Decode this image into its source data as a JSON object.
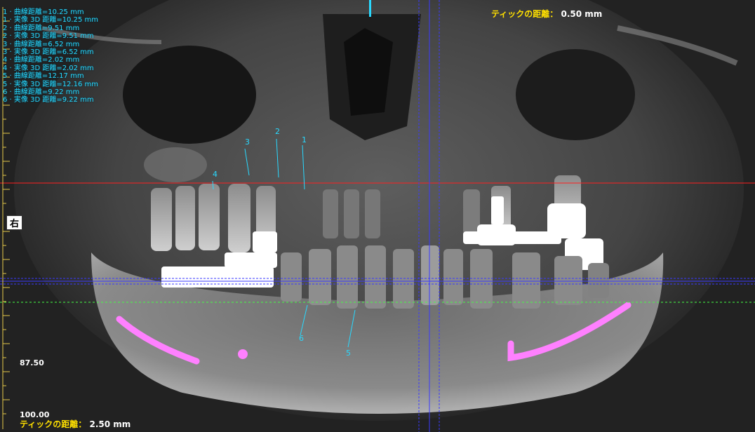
{
  "measurements": [
    "1 · 曲線距離=10.25 mm",
    "1 · 実像 3D 距離=10.25 mm",
    "2 · 曲線距離=9.51 mm",
    "2 · 実像 3D 距離=9.51 mm",
    "3 · 曲線距離=6.52 mm",
    "3 · 実像 3D 距離=6.52 mm",
    "4 · 曲線距離=2.02 mm",
    "4 · 実像 3D 距離=2.02 mm",
    "5 · 曲線距離=12.17 mm",
    "5 · 実像 3D 距離=12.16 mm",
    "6 · 曲線距離=9.22 mm",
    "6 · 実像 3D 距離=9.22 mm"
  ],
  "tick_top": {
    "label": "ティックの距離：",
    "value": "0.50 mm"
  },
  "tick_bottom": {
    "label": "ティックの距離：",
    "value": "2.50 mm"
  },
  "ruler": {
    "label_a": "87.50",
    "label_b": "100.00"
  },
  "side_label": "右",
  "marker_numbers": [
    "1",
    "2",
    "3",
    "4",
    "5",
    "6"
  ],
  "colors": {
    "measure": "#29d9ff",
    "nerve": "#ff80ff",
    "ref_red": "#ff2020",
    "ref_green": "#44ff44",
    "ref_blue": "#3a3aff"
  }
}
